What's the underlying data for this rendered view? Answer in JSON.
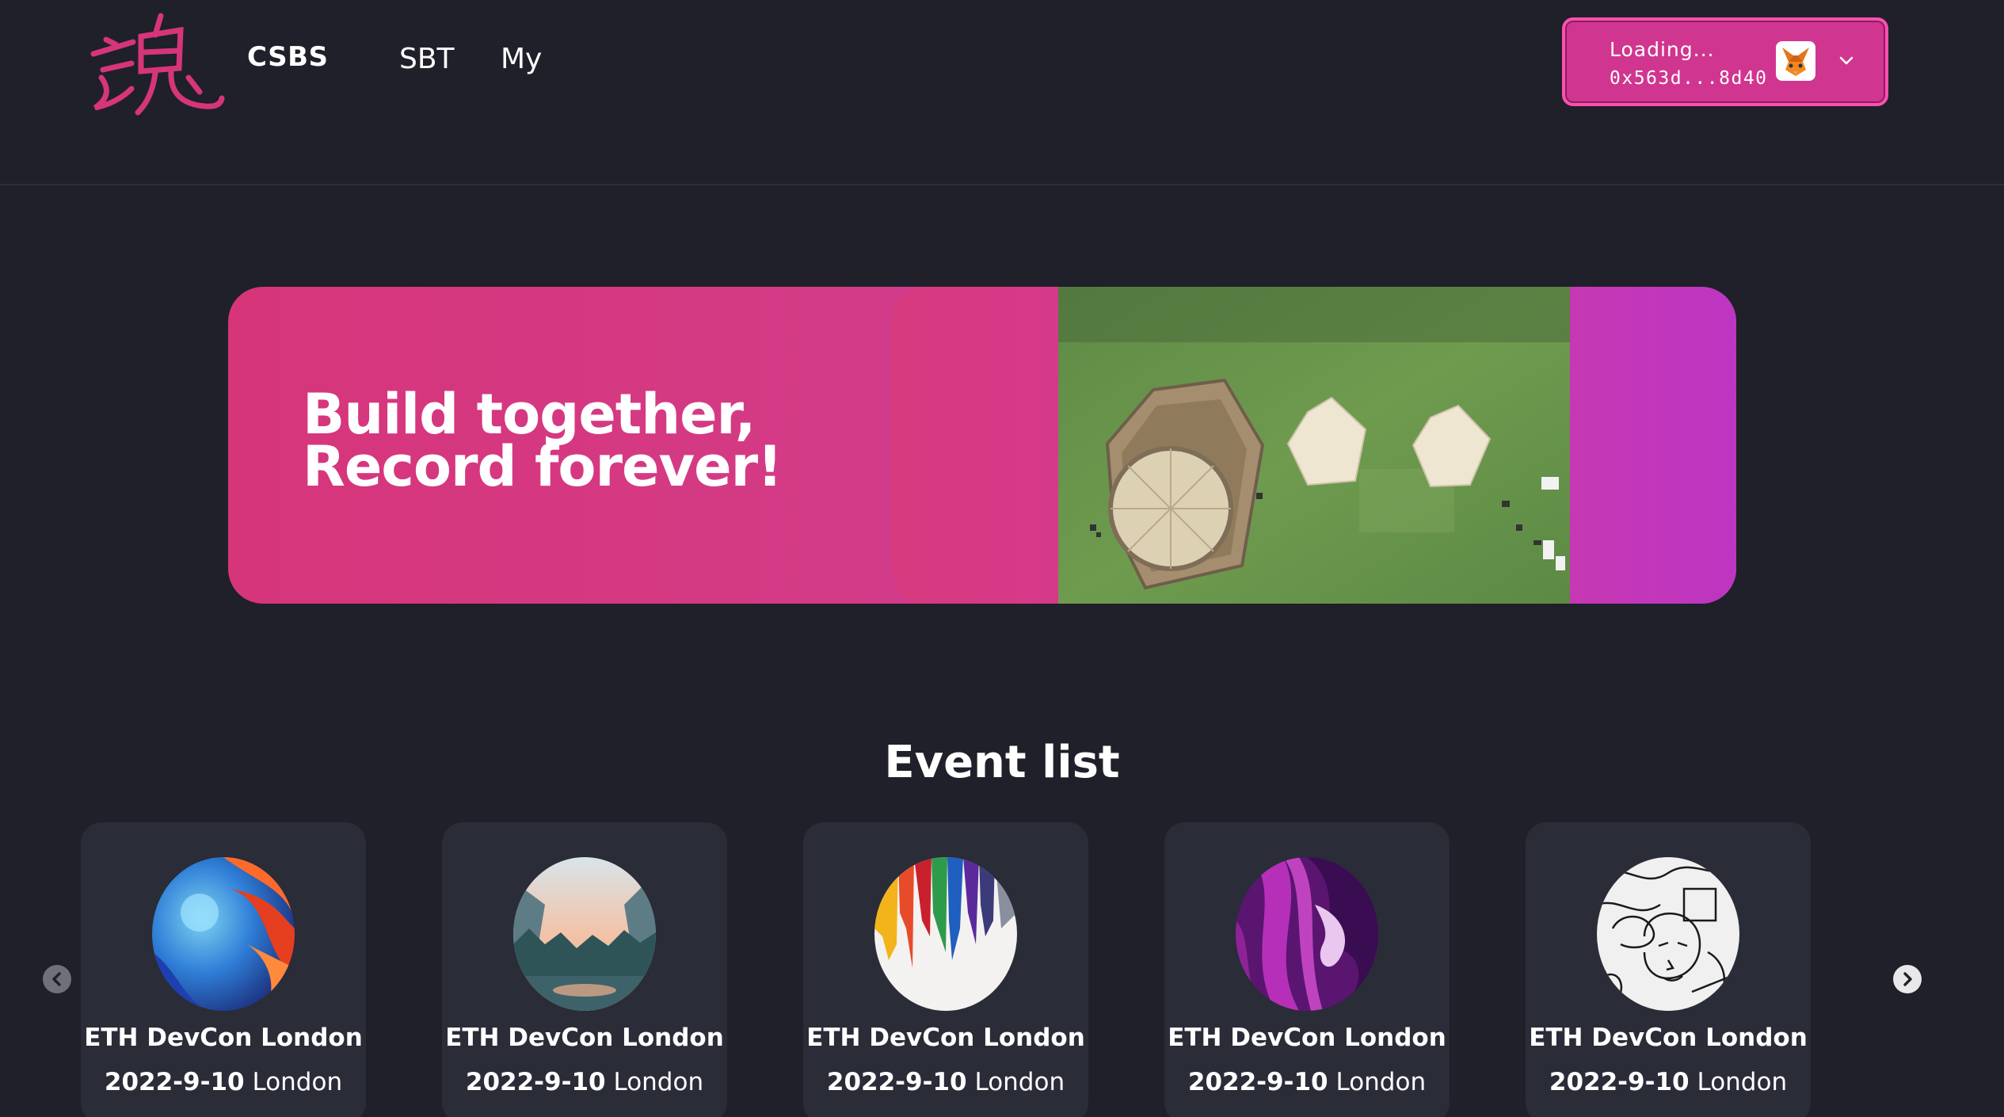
{
  "header": {
    "brand": "CSBS",
    "nav": [
      {
        "label": "SBT"
      },
      {
        "label": "My"
      }
    ],
    "wallet": {
      "status": "Loading...",
      "address": "0x563d...8d40",
      "icon": "metamask-fox-icon"
    },
    "logo_text": "魂"
  },
  "banner": {
    "line1": "Build together,",
    "line2": "Record forever!"
  },
  "events": {
    "title": "Event list",
    "items": [
      {
        "name": "ETH DevCon London",
        "date": "2022-9-10",
        "city": "London",
        "art": "blue-red-smoke"
      },
      {
        "name": "ETH DevCon London",
        "date": "2022-9-10",
        "city": "London",
        "art": "yosemite-valley"
      },
      {
        "name": "ETH DevCon London",
        "date": "2022-9-10",
        "city": "London",
        "art": "rainbow-paint-drip"
      },
      {
        "name": "ETH DevCon London",
        "date": "2022-9-10",
        "city": "London",
        "art": "purple-fluid"
      },
      {
        "name": "ETH DevCon London",
        "date": "2022-9-10",
        "city": "London",
        "art": "line-drawing-face"
      }
    ]
  },
  "colors": {
    "background": "#1f2029",
    "accent": "#d0368f",
    "card": "#2a2c38"
  }
}
